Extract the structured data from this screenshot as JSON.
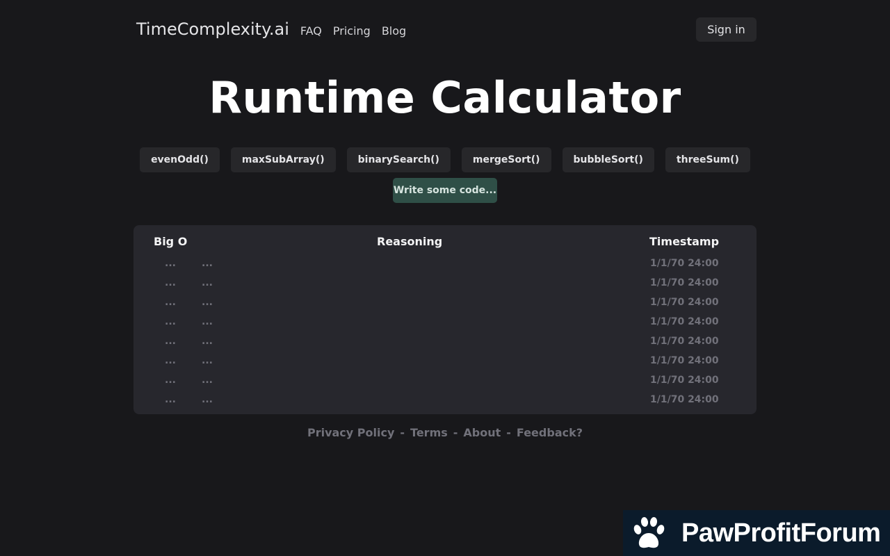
{
  "header": {
    "brand": "TimeComplexity.ai",
    "nav": [
      "FAQ",
      "Pricing",
      "Blog"
    ],
    "signin_label": "Sign in"
  },
  "title": "Runtime Calculator",
  "examples": [
    "evenOdd()",
    "maxSubArray()",
    "binarySearch()",
    "mergeSort()",
    "bubbleSort()",
    "threeSum()"
  ],
  "write_label": "Write some code...",
  "table": {
    "headers": {
      "big_o": "Big O",
      "reasoning": "Reasoning",
      "timestamp": "Timestamp"
    },
    "rows": [
      {
        "big_o": "...",
        "reasoning": "...",
        "timestamp": "1/1/70 24:00"
      },
      {
        "big_o": "...",
        "reasoning": "...",
        "timestamp": "1/1/70 24:00"
      },
      {
        "big_o": "...",
        "reasoning": "...",
        "timestamp": "1/1/70 24:00"
      },
      {
        "big_o": "...",
        "reasoning": "...",
        "timestamp": "1/1/70 24:00"
      },
      {
        "big_o": "...",
        "reasoning": "...",
        "timestamp": "1/1/70 24:00"
      },
      {
        "big_o": "...",
        "reasoning": "...",
        "timestamp": "1/1/70 24:00"
      },
      {
        "big_o": "...",
        "reasoning": "...",
        "timestamp": "1/1/70 24:00"
      },
      {
        "big_o": "...",
        "reasoning": "...",
        "timestamp": "1/1/70 24:00"
      }
    ]
  },
  "footer": {
    "links": [
      "Privacy Policy",
      "Terms",
      "About",
      "Feedback?"
    ],
    "separator": "-"
  },
  "watermark": {
    "text": "PawProfitForum",
    "icon": "paw-icon"
  },
  "colors": {
    "background": "#18181b",
    "panel": "#27272d",
    "accent_button": "#2f4f47",
    "muted_text": "#71717a"
  }
}
